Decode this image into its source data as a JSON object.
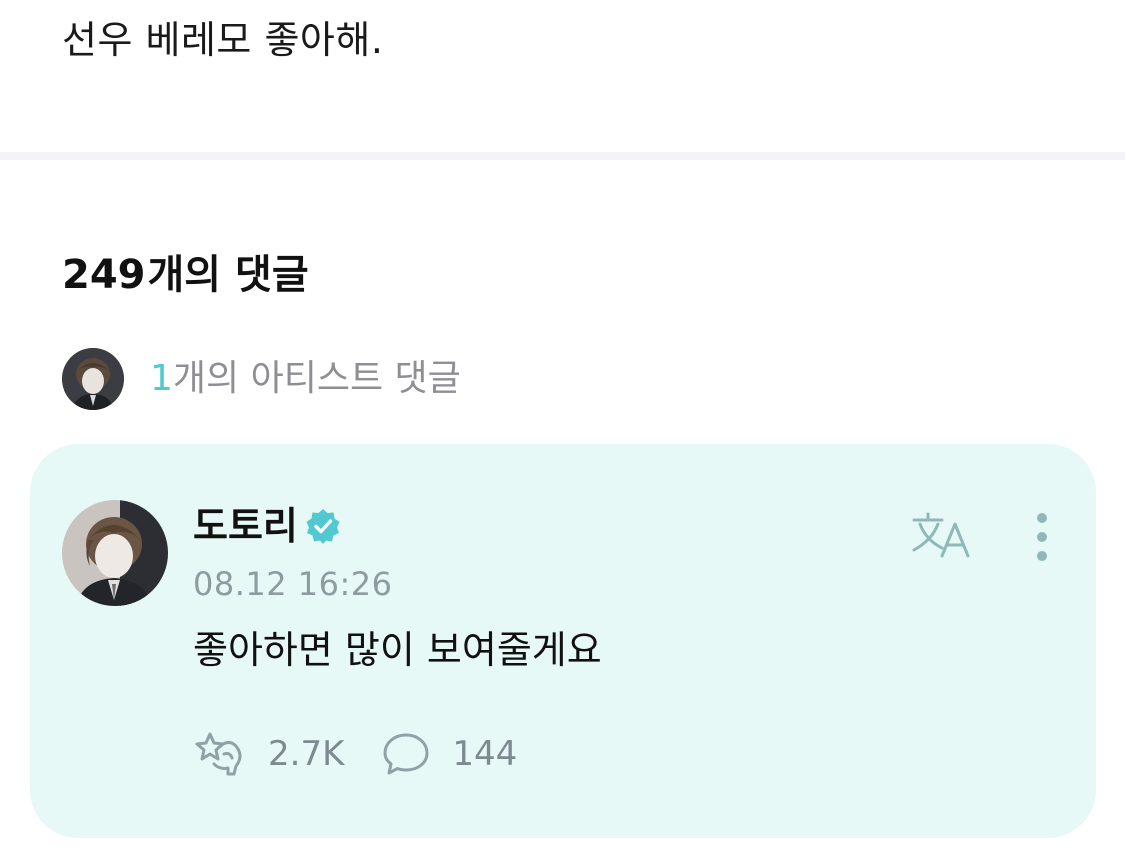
{
  "post": {
    "text": "선우 베레모 좋아해."
  },
  "comments": {
    "heading_count": "249",
    "heading_suffix": "개의 댓글",
    "artist_summary": {
      "count": "1",
      "suffix": "개의 아티스트 댓글"
    }
  },
  "artist_comment": {
    "author": "도토리",
    "verified_icon": "verified-badge-icon",
    "timestamp": "08.12 16:26",
    "body": "좋아하면 많이 보여줄게요",
    "likes": "2.7K",
    "replies": "144",
    "icons": {
      "translate": "translate-icon",
      "more": "more-vertical-icon",
      "like": "star-hand-icon",
      "reply": "speech-bubble-icon"
    }
  },
  "colors": {
    "accent": "#52c9d0",
    "card_background": "#e7f9f6",
    "muted_text": "#8e8e94"
  }
}
